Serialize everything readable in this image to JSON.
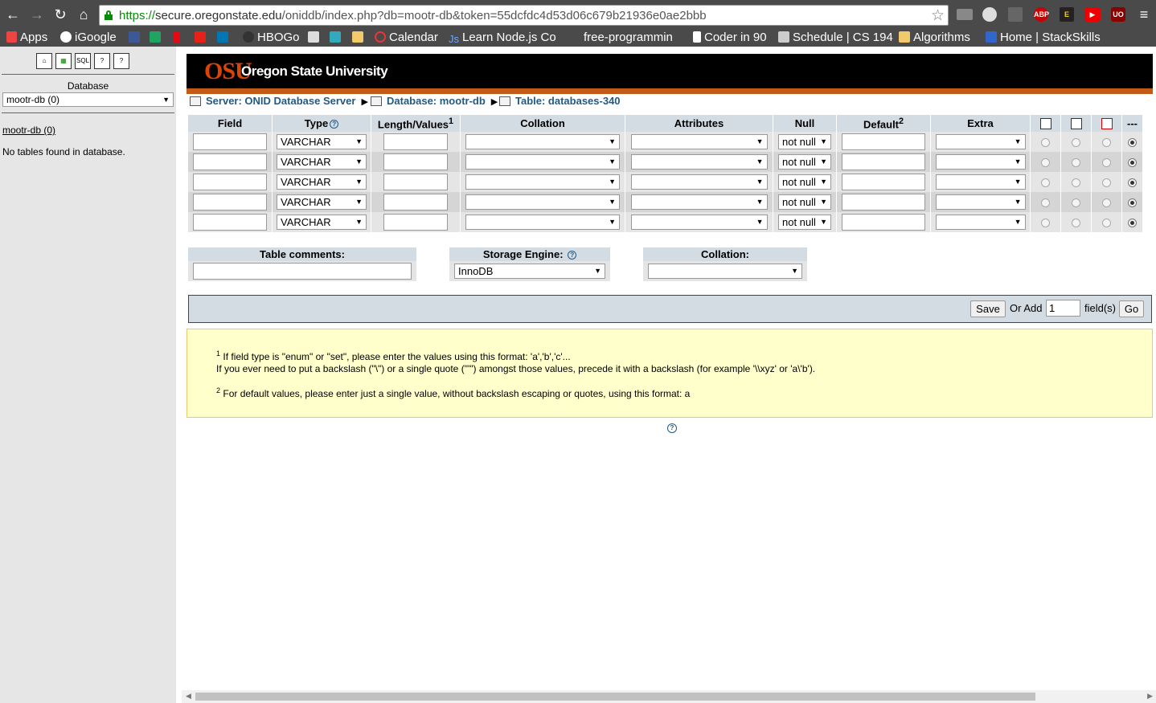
{
  "browser": {
    "url_protocol": "https://",
    "url_host": "secure.oregonstate.edu",
    "url_path": "/oniddb/index.php?db=mootr-db&token=55dcfdc4d53d06c679b21936e0ae2bbb",
    "ext_abp": "ABP",
    "ext_e": "E",
    "ext_uo": "UO"
  },
  "bookmarks": [
    "Apps",
    "iGoogle",
    "HBOGo",
    "Calendar",
    "Learn Node.js Co",
    "free-programmin",
    "Coder in 90",
    "Schedule | CS 194",
    "Algorithms",
    "Home | StackSkills"
  ],
  "sidebar": {
    "quick_icons": [
      "home-icon",
      "exit-icon",
      "sql-icon",
      "query-window-icon",
      "docs-icon"
    ],
    "database_label": "Database",
    "database_selected": "mootr-db (0)",
    "db_link": "mootr-db (0)",
    "no_tables": "No tables found in database."
  },
  "banner": {
    "logo": "OSU",
    "university": "Oregon State University"
  },
  "breadcrumb": {
    "server": "Server: ONID Database Server",
    "database": "Database: mootr-db",
    "table": "Table: databases-340"
  },
  "structure": {
    "headers": {
      "field": "Field",
      "type": "Type",
      "length": "Length/Values",
      "length_sup": "1",
      "collation": "Collation",
      "attributes": "Attributes",
      "null": "Null",
      "default": "Default",
      "default_sup": "2",
      "extra": "Extra",
      "last": "---"
    },
    "rows": [
      {
        "field": "",
        "type": "VARCHAR",
        "length": "",
        "collation": "",
        "attributes": "",
        "null": "not null",
        "default": "",
        "extra": "",
        "index": "none"
      },
      {
        "field": "",
        "type": "VARCHAR",
        "length": "",
        "collation": "",
        "attributes": "",
        "null": "not null",
        "default": "",
        "extra": "",
        "index": "none"
      },
      {
        "field": "",
        "type": "VARCHAR",
        "length": "",
        "collation": "",
        "attributes": "",
        "null": "not null",
        "default": "",
        "extra": "",
        "index": "none"
      },
      {
        "field": "",
        "type": "VARCHAR",
        "length": "",
        "collation": "",
        "attributes": "",
        "null": "not null",
        "default": "",
        "extra": "",
        "index": "none"
      },
      {
        "field": "",
        "type": "VARCHAR",
        "length": "",
        "collation": "",
        "attributes": "",
        "null": "not null",
        "default": "",
        "extra": "",
        "index": "none"
      }
    ]
  },
  "table_options": {
    "comments_label": "Table comments:",
    "comments_value": "",
    "engine_label": "Storage Engine:",
    "engine_value": "InnoDB",
    "collation_label": "Collation:",
    "collation_value": ""
  },
  "actions": {
    "save": "Save",
    "or_add": "Or Add",
    "add_count": "1",
    "fields": "field(s)",
    "go": "Go"
  },
  "notes": {
    "note1_num": "1",
    "note1_line1": "If field type is \"enum\" or \"set\", please enter the values using this format: 'a','b','c'...",
    "note1_line2": "If you ever need to put a backslash (\"\\\") or a single quote (\"'\") amongst those values, precede it with a backslash (for example '\\\\xyz' or 'a\\'b').",
    "note2_num": "2",
    "note2_line": "For default values, please enter just a single value, without backslash escaping or quotes, using this format: a"
  }
}
